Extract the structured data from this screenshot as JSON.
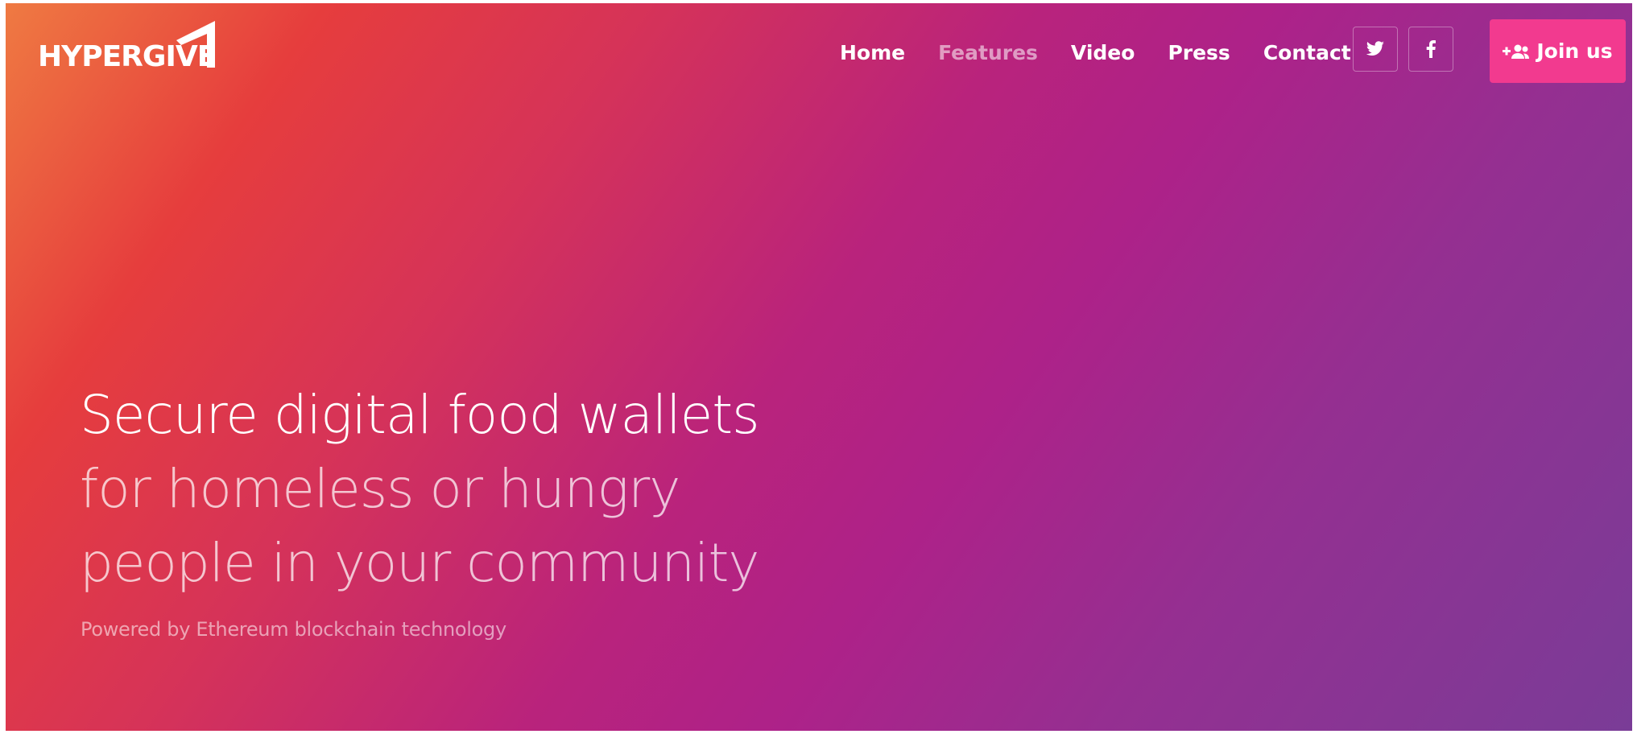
{
  "brand": {
    "name": "HYPERGIVE",
    "logo_icon": "paper-plane-icon"
  },
  "nav": {
    "items": [
      {
        "label": "Home",
        "active": false
      },
      {
        "label": "Features",
        "active": true
      },
      {
        "label": "Video",
        "active": false
      },
      {
        "label": "Press",
        "active": false
      },
      {
        "label": "Contact",
        "active": false
      }
    ]
  },
  "social": {
    "twitter_icon": "twitter-icon",
    "facebook_icon": "facebook-icon"
  },
  "cta": {
    "join_label": "Join us",
    "join_icon": "add-user-icon",
    "color": "#f23a8f"
  },
  "hero": {
    "headline_line1": "Secure digital food wallets",
    "headline_line2": "for homeless or hungry",
    "headline_line3": "people in your community",
    "subline": "Powered by Ethereum blockchain technology",
    "gradient_colors": [
      "#ef7a42",
      "#e63d3d",
      "#b9237c",
      "#7a3c97"
    ]
  }
}
